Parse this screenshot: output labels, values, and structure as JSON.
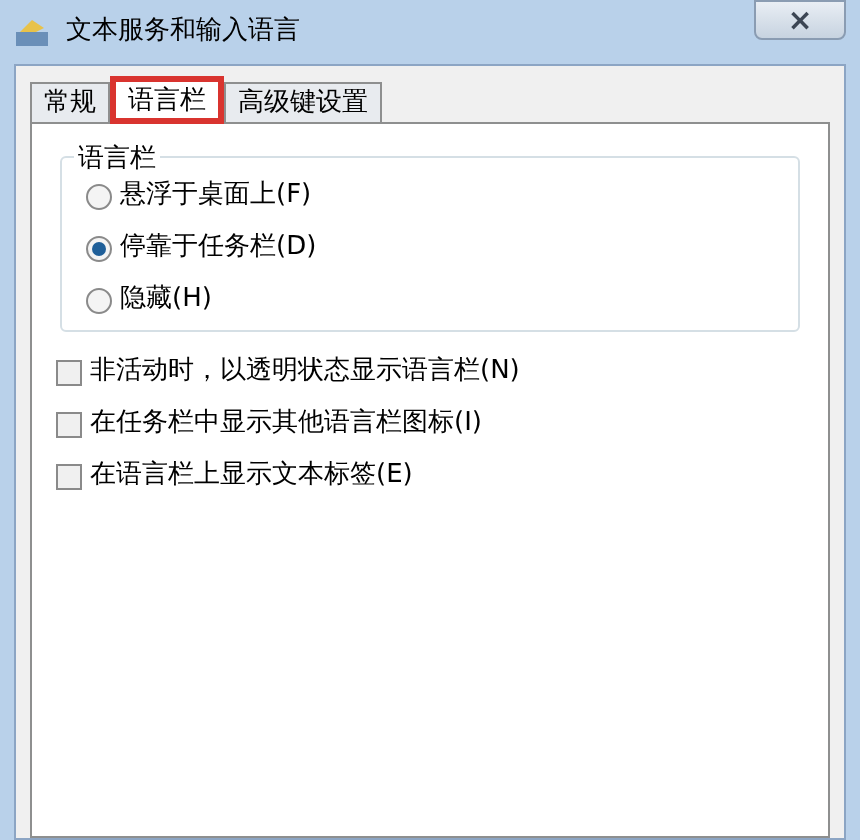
{
  "window": {
    "title": "文本服务和输入语言",
    "close": "×"
  },
  "tabs": [
    {
      "label": "常规",
      "selected": false
    },
    {
      "label": "语言栏",
      "selected": true
    },
    {
      "label": "高级键设置",
      "selected": false
    }
  ],
  "group": {
    "title": "语言栏",
    "options": [
      {
        "label": "悬浮于桌面上(F)",
        "selected": false
      },
      {
        "label": "停靠于任务栏(D)",
        "selected": true
      },
      {
        "label": "隐藏(H)",
        "selected": false
      }
    ]
  },
  "checkboxes": [
    {
      "label": "非活动时，以透明状态显示语言栏(N)",
      "checked": false
    },
    {
      "label": "在任务栏中显示其他语言栏图标(I)",
      "checked": false
    },
    {
      "label": "在语言栏上显示文本标签(E)",
      "checked": false
    }
  ]
}
